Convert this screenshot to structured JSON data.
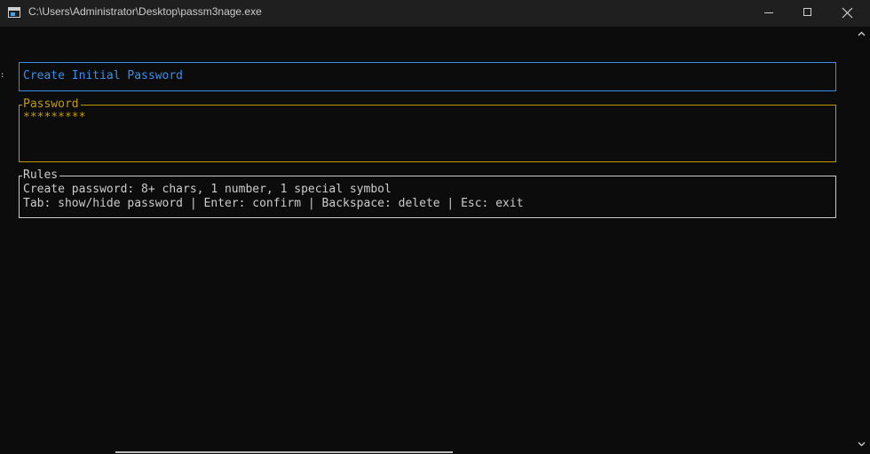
{
  "window": {
    "title": "C:\\Users\\Administrator\\Desktop\\passm3nage.exe",
    "icon": "console-app-icon"
  },
  "controls": {
    "minimize_icon": "minimize-icon",
    "maximize_icon": "maximize-icon",
    "close_icon": "close-icon"
  },
  "header": {
    "title": "Create Initial Password"
  },
  "password": {
    "label": "Password",
    "value": "*********"
  },
  "rules": {
    "label": "Rules",
    "line1": "Create password: 8+ chars, 1 number, 1 special symbol",
    "line2": "Tab: show/hide password | Enter: confirm | Backspace: delete | Esc: exit"
  },
  "colors": {
    "background": "#0c0c0c",
    "titlebar": "#1f1f1f",
    "header_accent": "#3b8eea",
    "password_accent": "#c19c00",
    "rules_text": "#cccccc"
  }
}
